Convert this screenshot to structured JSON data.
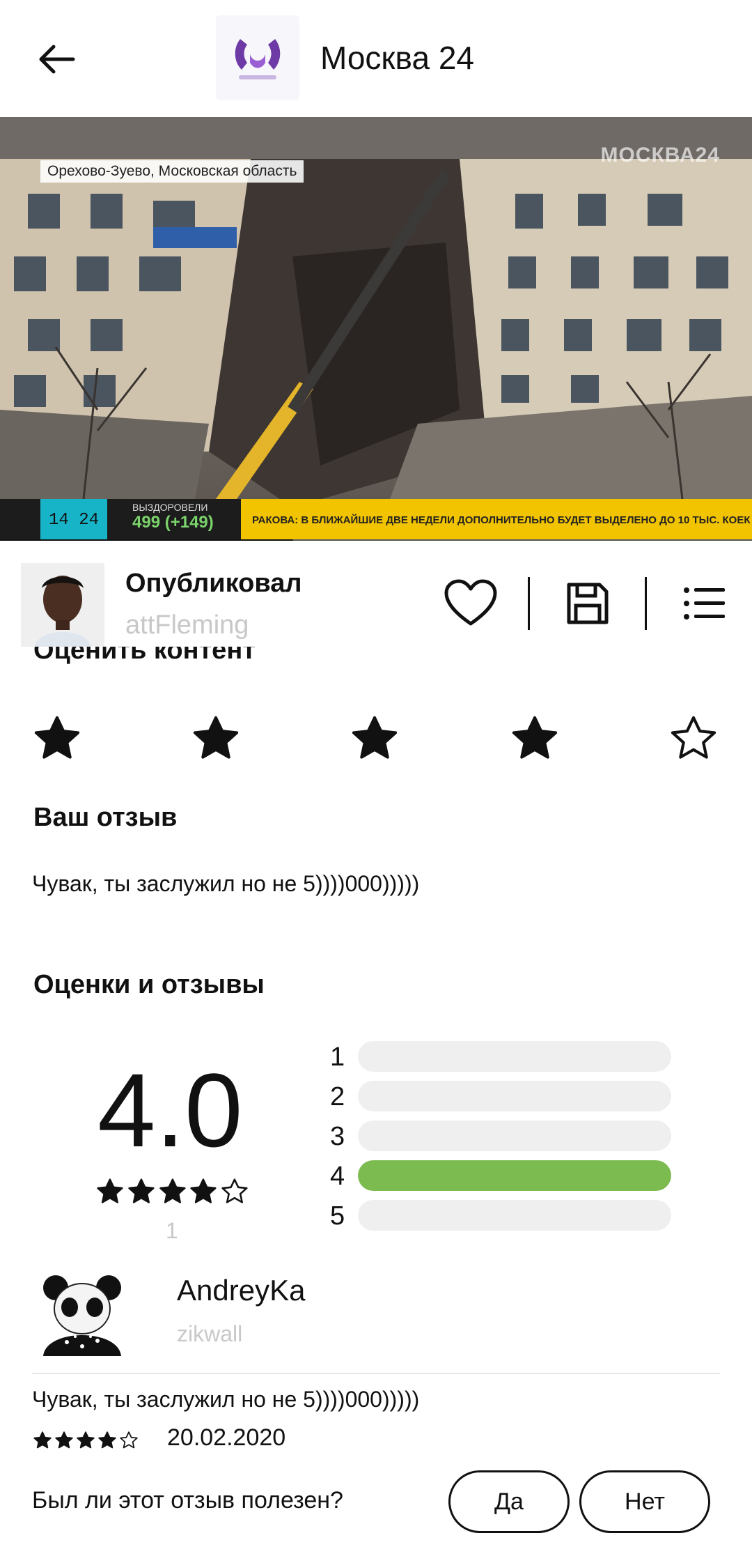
{
  "header": {
    "title": "Москва 24"
  },
  "video": {
    "location": "Орехово-Зуево, Московская область",
    "watermark": "МОСКВА24",
    "ticker_time": "14 24",
    "recovered_label": "ВЫЗДОРОВЕЛИ",
    "recovered_value": "499 (+149)",
    "news": "РАКОВА: В БЛИЖАЙШИЕ ДВЕ НЕДЕЛИ ДОПОЛНИТЕЛЬНО БУДЕТ ВЫДЕЛЕНО ДО 10 ТЫС. КОЕК",
    "progress": 0.39
  },
  "publisher": {
    "title": "Опубликовал",
    "username": "attFleming"
  },
  "rate_section": {
    "heading": "Оценить контент",
    "selected_stars": 4,
    "max_stars": 5
  },
  "your_review": {
    "heading": "Ваш отзыв",
    "text": "Чувак, ты заслужил но не 5))))000)))))"
  },
  "ratings": {
    "heading": "Оценки и отзывы",
    "average": "4.0",
    "average_stars": 4,
    "count": "1",
    "distribution": [
      {
        "label": "1",
        "fraction": 0
      },
      {
        "label": "2",
        "fraction": 0
      },
      {
        "label": "3",
        "fraction": 0
      },
      {
        "label": "4",
        "fraction": 1
      },
      {
        "label": "5",
        "fraction": 0
      }
    ]
  },
  "review": {
    "name": "AndreyKa",
    "username": "zikwall",
    "text": "Чувак, ты заслужил но не 5))))000)))))",
    "stars": 4,
    "date": "20.02.2020",
    "helpful_question": "Был ли этот отзыв полезен?",
    "yes_label": "Да",
    "no_label": "Нет"
  },
  "colors": {
    "accent_bar": "#7cbb4f",
    "ticker_yellow": "#f2c400",
    "ticker_cyan": "#17b4c8"
  }
}
